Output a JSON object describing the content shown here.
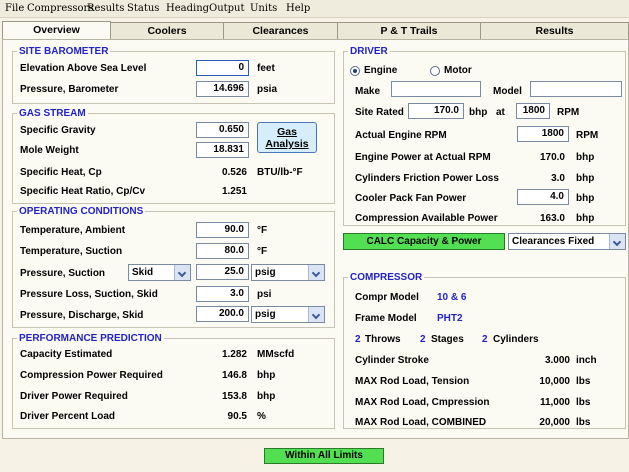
{
  "menu": [
    "File",
    "Compressors",
    "Results",
    "Status",
    "Heading",
    "Output",
    "Units",
    "Help"
  ],
  "tabs": [
    "Overview",
    "Coolers",
    "Clearances",
    "P & T Trails",
    "Results"
  ],
  "site_barometer": {
    "title": "SITE BAROMETER",
    "elevation_label": "Elevation Above Sea Level",
    "elevation_value": "0",
    "elevation_unit": "feet",
    "pressure_label": "Pressure, Barometer",
    "pressure_value": "14.696",
    "pressure_unit": "psia"
  },
  "gas_stream": {
    "title": "GAS STREAM",
    "sg_label": "Specific Gravity",
    "sg_value": "0.650",
    "mw_label": "Mole Weight",
    "mw_value": "18.831",
    "cp_label": "Specific Heat, Cp",
    "cp_value": "0.526",
    "cp_unit": "BTU/lb-°F",
    "ratio_label": "Specific Heat Ratio, Cp/Cv",
    "ratio_value": "1.251",
    "analysis_button_line1": "Gas",
    "analysis_button_line2": "Analysis"
  },
  "operating": {
    "title": "OPERATING CONDITIONS",
    "t_ambient_label": "Temperature, Ambient",
    "t_ambient_value": "90.0",
    "t_ambient_unit": "°F",
    "t_suction_label": "Temperature, Suction",
    "t_suction_value": "80.0",
    "t_suction_unit": "°F",
    "p_suction_label": "Pressure, Suction",
    "p_suction_location": "Skid",
    "p_suction_value": "25.0",
    "p_suction_unit": "psig",
    "p_loss_label": "Pressure Loss, Suction, Skid",
    "p_loss_value": "3.0",
    "p_loss_unit": "psi",
    "p_discharge_label": "Pressure, Discharge, Skid",
    "p_discharge_value": "200.0",
    "p_discharge_unit": "psig"
  },
  "performance": {
    "title": "PERFORMANCE PREDICTION",
    "capacity_label": "Capacity Estimated",
    "capacity_value": "1.282",
    "capacity_unit": "MMscfd",
    "comp_power_label": "Compression Power Required",
    "comp_power_value": "146.8",
    "comp_power_unit": "bhp",
    "driver_power_label": "Driver Power Required",
    "driver_power_value": "153.8",
    "driver_power_unit": "bhp",
    "driver_load_label": "Driver Percent Load",
    "driver_load_value": "90.5",
    "driver_load_unit": "%"
  },
  "driver": {
    "title": "DRIVER",
    "engine_label": "Engine",
    "motor_label": "Motor",
    "engine_selected": true,
    "make_label": "Make",
    "make_value": "",
    "model_label": "Model",
    "model_value": "",
    "site_rated_label": "Site Rated",
    "site_rated_value": "170.0",
    "site_rated_unit": "bhp",
    "at_label": "at",
    "rated_rpm_value": "1800",
    "rpm_unit": "RPM",
    "actual_rpm_label": "Actual Engine RPM",
    "actual_rpm_value": "1800",
    "actual_rpm_unit": "RPM",
    "engine_power_label": "Engine Power at Actual RPM",
    "engine_power_value": "170.0",
    "engine_power_unit": "bhp",
    "friction_label": "Cylinders Friction Power Loss",
    "friction_value": "3.0",
    "friction_unit": "bhp",
    "fan_label": "Cooler Pack Fan Power",
    "fan_value": "4.0",
    "fan_unit": "bhp",
    "available_label": "Compression Available Power",
    "available_value": "163.0",
    "available_unit": "bhp"
  },
  "actions": {
    "calc_button": "CALC Capacity & Power",
    "clearance_select": "Clearances Fixed"
  },
  "compressor": {
    "title": "COMPRESSOR",
    "model_label": "Compr Model",
    "model_value": "10 & 6",
    "frame_label": "Frame Model",
    "frame_value": "PHT2",
    "throws_value": "2",
    "throws_label": "Throws",
    "stages_value": "2",
    "stages_label": "Stages",
    "cylinders_value": "2",
    "cylinders_label": "Cylinders",
    "stroke_label": "Cylinder Stroke",
    "stroke_value": "3.000",
    "stroke_unit": "inch",
    "tension_label": "MAX Rod Load, Tension",
    "tension_value": "10,000",
    "tension_unit": "lbs",
    "compression_label": "MAX Rod Load, Cmpression",
    "compression_value": "11,000",
    "compression_unit": "lbs",
    "combined_label": "MAX Rod Load, COMBINED",
    "combined_value": "20,000",
    "combined_unit": "lbs"
  },
  "status": {
    "text": "Within All Limits",
    "color": "#52e052"
  },
  "colors": {
    "section_title": "#2323c8",
    "button_green": "#52e052",
    "gas_button": "#d6eefa",
    "panel_bg": "#fbfaf3"
  }
}
